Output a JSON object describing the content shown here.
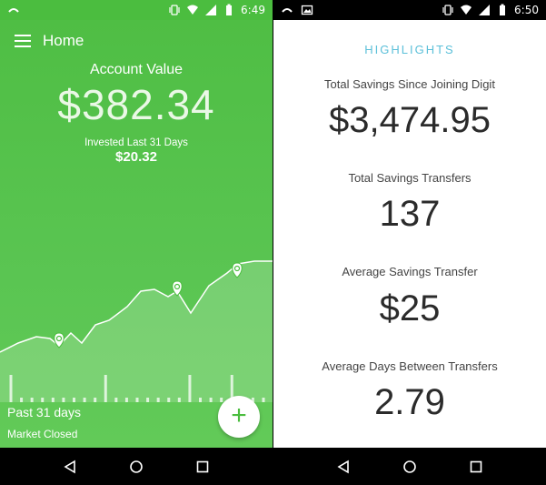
{
  "status_left": {
    "time": "6:49"
  },
  "status_right": {
    "time": "6:50"
  },
  "home": {
    "title": "Home",
    "account_label": "Account Value",
    "account_value": "$382.34",
    "invested_label": "Invested Last 31 Days",
    "invested_value": "$20.32",
    "period": "Past 31 days",
    "market_status": "Market Closed",
    "add_icon": "plus-icon"
  },
  "highlights": {
    "title": "HIGHLIGHTS",
    "stats": [
      {
        "label": "Total Savings Since Joining Digit",
        "value": "$3,474.95"
      },
      {
        "label": "Total Savings Transfers",
        "value": "137"
      },
      {
        "label": "Average Savings Transfer",
        "value": "$25"
      },
      {
        "label": "Average Days Between Transfers",
        "value": "2.79"
      }
    ]
  },
  "colors": {
    "brand_green": "#4bbd3f",
    "highlight_blue": "#5cc0d9"
  },
  "nav_icons": [
    "back-icon",
    "home-icon",
    "recents-icon"
  ]
}
